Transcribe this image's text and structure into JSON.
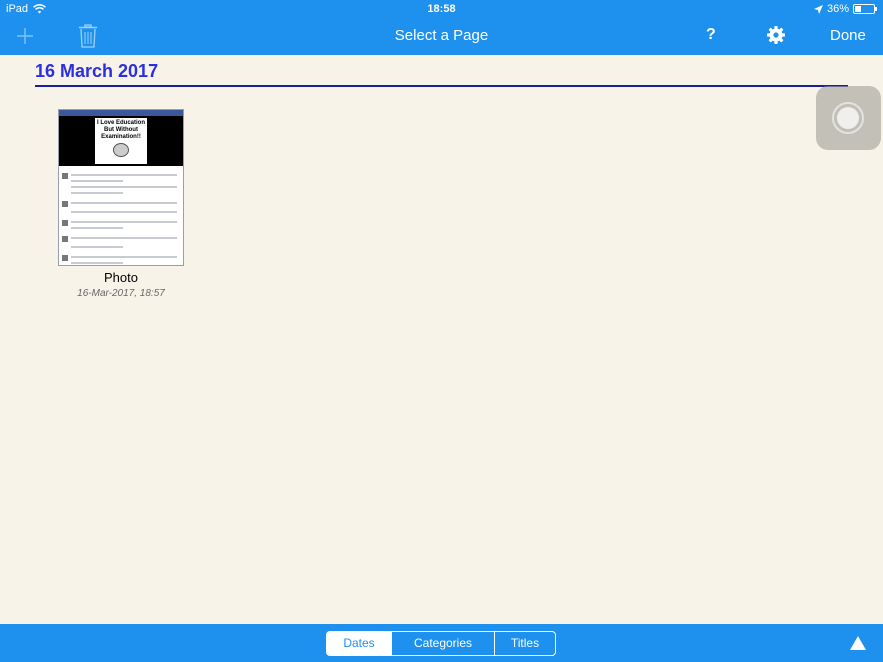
{
  "status": {
    "device": "iPad",
    "time": "18:58",
    "battery": "36%",
    "battery_level": 0.36
  },
  "navbar": {
    "title": "Select a Page",
    "help_label": "?",
    "done_label": "Done"
  },
  "section": {
    "date_heading": "16 March 2017"
  },
  "items": [
    {
      "label": "Photo",
      "date": "16-Mar-2017, 18:57",
      "thumbnail_text": "I Love Education But Without Examination!!"
    }
  ],
  "segments": [
    {
      "label": "Dates",
      "active": true
    },
    {
      "label": "Categories",
      "active": false
    },
    {
      "label": "Titles",
      "active": false
    }
  ],
  "colors": {
    "bar": "#1e90ee",
    "heading": "#2b2fe0",
    "background": "#f8f3e8"
  }
}
